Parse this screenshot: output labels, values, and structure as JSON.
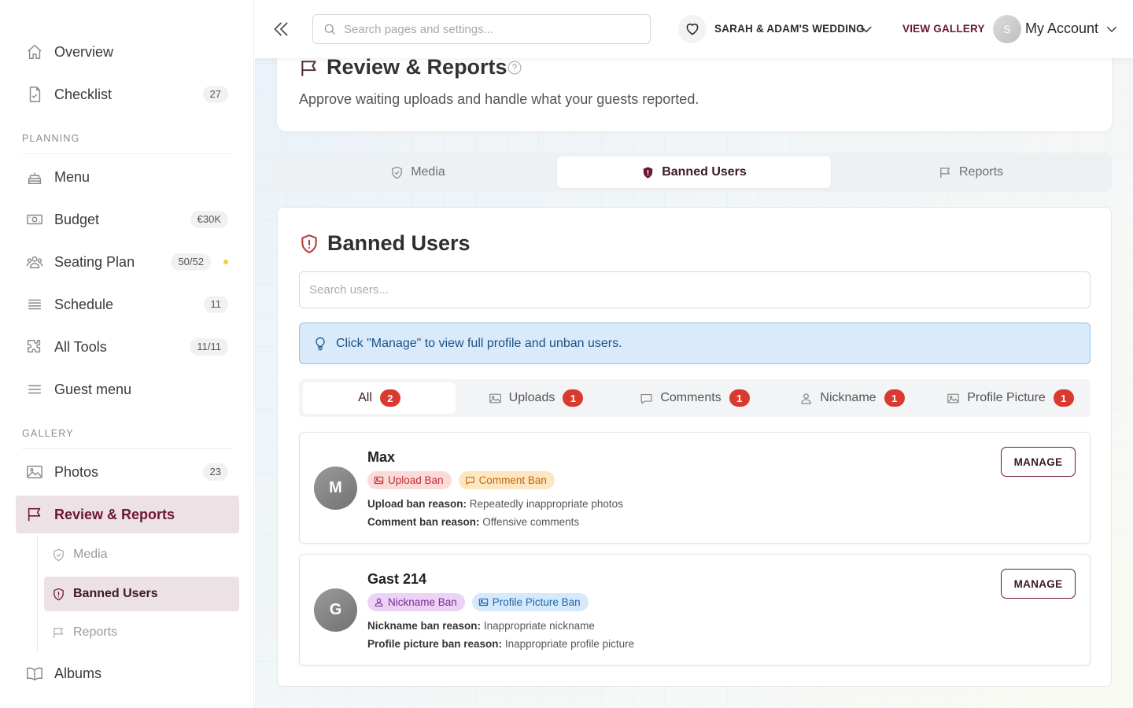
{
  "sidebar": {
    "items": [
      {
        "label": "Overview",
        "icon": "home-icon"
      },
      {
        "label": "Checklist",
        "icon": "checklist-icon",
        "badge": "27"
      }
    ],
    "planning": {
      "title": "PLANNING",
      "items": [
        {
          "label": "Menu",
          "icon": "cake-icon"
        },
        {
          "label": "Budget",
          "icon": "money-icon",
          "badge": "€30K"
        },
        {
          "label": "Seating Plan",
          "icon": "people-icon",
          "badge": "50/52",
          "status_dot_color": "#f5d033"
        },
        {
          "label": "Schedule",
          "icon": "list-icon",
          "badge": "11"
        },
        {
          "label": "All Tools",
          "icon": "puzzle-icon",
          "badge": "11/11"
        },
        {
          "label": "Guest menu",
          "icon": "menu-icon"
        }
      ]
    },
    "gallery": {
      "title": "GALLERY",
      "items": [
        {
          "label": "Photos",
          "icon": "image-icon",
          "badge": "23"
        },
        {
          "label": "Review & Reports",
          "icon": "flag-icon",
          "active": true
        }
      ],
      "subitems": [
        {
          "label": "Media",
          "icon": "shield-check-icon"
        },
        {
          "label": "Banned Users",
          "icon": "shield-alert-icon",
          "active": true
        },
        {
          "label": "Reports",
          "icon": "flag-icon"
        }
      ],
      "after": [
        {
          "label": "Albums",
          "icon": "book-icon"
        }
      ]
    }
  },
  "topbar": {
    "search_placeholder": "Search pages and settings...",
    "wedding_name": "SARAH & ADAM'S WEDDING",
    "view_gallery": "VIEW GALLERY",
    "avatar_initial": "S",
    "account_label": "My Account"
  },
  "header": {
    "title": "Review & Reports",
    "subtitle": "Approve waiting uploads and handle what your guests reported."
  },
  "tabs": [
    {
      "label": "Media",
      "icon": "shield-check-icon"
    },
    {
      "label": "Banned Users",
      "icon": "shield-alert-icon",
      "active": true
    },
    {
      "label": "Reports",
      "icon": "flag-icon"
    }
  ],
  "banned": {
    "title": "Banned Users",
    "search_placeholder": "Search users...",
    "info": "Click \"Manage\" to view full profile and unban users.",
    "filters": [
      {
        "label": "All",
        "count": "2",
        "active": true
      },
      {
        "label": "Uploads",
        "icon": "image-icon",
        "count": "1"
      },
      {
        "label": "Comments",
        "icon": "comment-icon",
        "count": "1"
      },
      {
        "label": "Nickname",
        "icon": "user-icon",
        "count": "1"
      },
      {
        "label": "Profile Picture",
        "icon": "image-icon",
        "count": "1"
      }
    ],
    "users": [
      {
        "initial": "M",
        "name": "Max",
        "chips": [
          {
            "label": "Upload Ban",
            "icon": "image-icon",
            "color": "#c22f2f"
          },
          {
            "label": "Comment Ban",
            "icon": "comment-icon",
            "color": "#c06a0a"
          }
        ],
        "reasons": [
          {
            "label": "Upload ban reason:",
            "text": "Repeatedly inappropriate photos"
          },
          {
            "label": "Comment ban reason:",
            "text": "Offensive comments"
          }
        ],
        "manage_label": "MANAGE"
      },
      {
        "initial": "G",
        "name": "Gast 214",
        "chips": [
          {
            "label": "Nickname Ban",
            "icon": "user-icon",
            "color": "#7c2c98"
          },
          {
            "label": "Profile Picture Ban",
            "icon": "image-icon",
            "color": "#1e67ab"
          }
        ],
        "reasons": [
          {
            "label": "Nickname ban reason:",
            "text": "Inappropriate nickname"
          },
          {
            "label": "Profile picture ban reason:",
            "text": "Inappropriate profile picture"
          }
        ],
        "manage_label": "MANAGE"
      }
    ]
  },
  "colors": {
    "accent": "#6e1730",
    "active_bg": "#ece1e5",
    "count_badge": "#d93a2f",
    "info_bg": "#d9ebfb"
  }
}
